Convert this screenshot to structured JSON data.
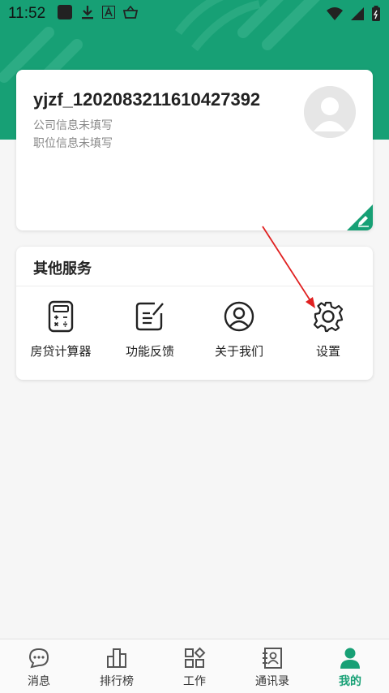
{
  "status_bar": {
    "time": "11:52"
  },
  "profile": {
    "username": "yjzf_1202083211610427392",
    "company": "公司信息未填写",
    "position": "职位信息未填写"
  },
  "services": {
    "title": "其他服务",
    "items": [
      {
        "label": "房贷计算器",
        "icon": "calculator-icon"
      },
      {
        "label": "功能反馈",
        "icon": "feedback-icon"
      },
      {
        "label": "关于我们",
        "icon": "about-us-icon"
      },
      {
        "label": "设置",
        "icon": "gear-icon"
      }
    ]
  },
  "tabs": [
    {
      "label": "消息",
      "icon": "chat-bubble-icon",
      "active": false
    },
    {
      "label": "排行榜",
      "icon": "ranking-icon",
      "active": false
    },
    {
      "label": "工作",
      "icon": "grid-apps-icon",
      "active": false
    },
    {
      "label": "通讯录",
      "icon": "contacts-icon",
      "active": false
    },
    {
      "label": "我的",
      "icon": "person-icon",
      "active": true
    }
  ],
  "colors": {
    "brand": "#17a075",
    "annotation_arrow": "#e02020"
  }
}
